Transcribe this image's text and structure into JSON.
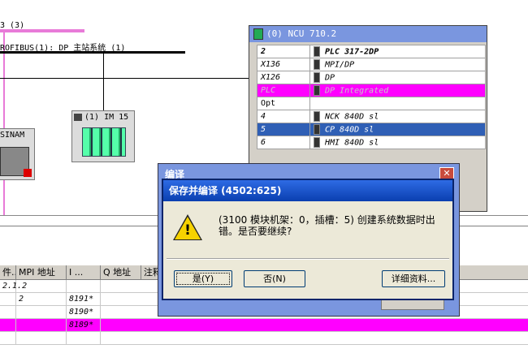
{
  "network": {
    "top_label": "3 (3)",
    "profibus_label": "ROFIBUS(1): DP 主站系统 (1)",
    "im_label": "(1) IM 15",
    "sinam_label": "SINAM"
  },
  "station": {
    "title": "(0) NCU 710.2",
    "slots": [
      {
        "slot": "2",
        "module": "PLC 317-2DP",
        "style": "bold"
      },
      {
        "slot": "X136",
        "module": "MPI/DP",
        "style": "italic"
      },
      {
        "slot": "X126",
        "module": "DP",
        "style": "italic"
      },
      {
        "slot": "PLC",
        "module": "DP Integrated",
        "style": "pink"
      },
      {
        "slot": "Opt",
        "module": "",
        "style": "plain"
      },
      {
        "slot": "4",
        "module": "NCK 840D sl",
        "style": "italic"
      },
      {
        "slot": "5",
        "module": "CP 840D sl",
        "style": "blue"
      },
      {
        "slot": "6",
        "module": "HMI 840D sl",
        "style": "italic"
      }
    ]
  },
  "grid": {
    "headers": [
      "件...",
      "MPI 地址",
      "I ...",
      "Q 地址",
      "注释"
    ],
    "rows": [
      {
        "c0": "2.1.2",
        "c1": "",
        "c2": "",
        "pink": false
      },
      {
        "c0": "",
        "c1": "2",
        "c2": "8191*",
        "pink": false
      },
      {
        "c0": "",
        "c1": "",
        "c2": "8190*",
        "pink": false
      },
      {
        "c0": "",
        "c1": "",
        "c2": "8189*",
        "pink": true
      },
      {
        "c0": "",
        "c1": "",
        "c2": "",
        "pink": false
      }
    ]
  },
  "bg_dialog": {
    "title": "编译",
    "close": "✕"
  },
  "dialog": {
    "title": "保存并编译 (4502:625)",
    "message": "(3100 模块机架：0，插槽：5) 创建系统数据时出错。是否要继续?",
    "buttons": {
      "yes": "是(Y)",
      "no": "否(N)",
      "details": "详细资料..."
    }
  }
}
